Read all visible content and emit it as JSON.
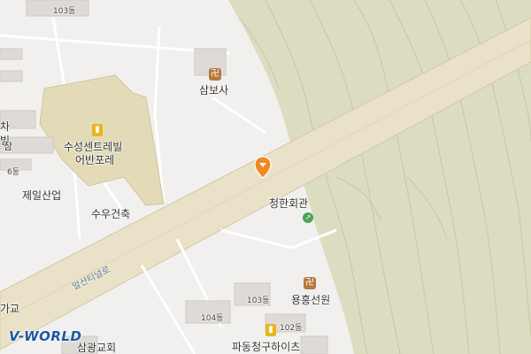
{
  "map": {
    "places": {
      "sambosa": "삼보사",
      "suseong_line1": "수성센트레빌",
      "suseong_line2": "어반포레",
      "jeil": "제일산업",
      "suwoo": "수우건축",
      "cheonghan": "청한회관",
      "yongheung": "용흥선원",
      "padong": "파동청구하이츠",
      "samgwang": "삼광교회",
      "left_cut1": "차",
      "left_cut2": "빌",
      "left_cut3": "삼",
      "left_cut4": "가교"
    },
    "buildings": {
      "b103_top": "103동",
      "b6": "6동",
      "b103": "103동",
      "b104": "104동",
      "b102": "102동"
    },
    "roads": {
      "alsanti": "알산티널로"
    },
    "icon_names": {
      "temple": "temple-icon",
      "apartment": "apartment-icon",
      "facility": "facility-icon",
      "pin": "location-pin-icon"
    },
    "logo": "V-WORLD",
    "colors": {
      "land": "#f1f0ee",
      "mountain": "#dcdcc0",
      "highway": "#e9e2c8",
      "building": "#dedad6",
      "temple_icon": "#b57b3d",
      "apartment_icon": "#e8b617",
      "pin": "#f08a1e"
    }
  }
}
